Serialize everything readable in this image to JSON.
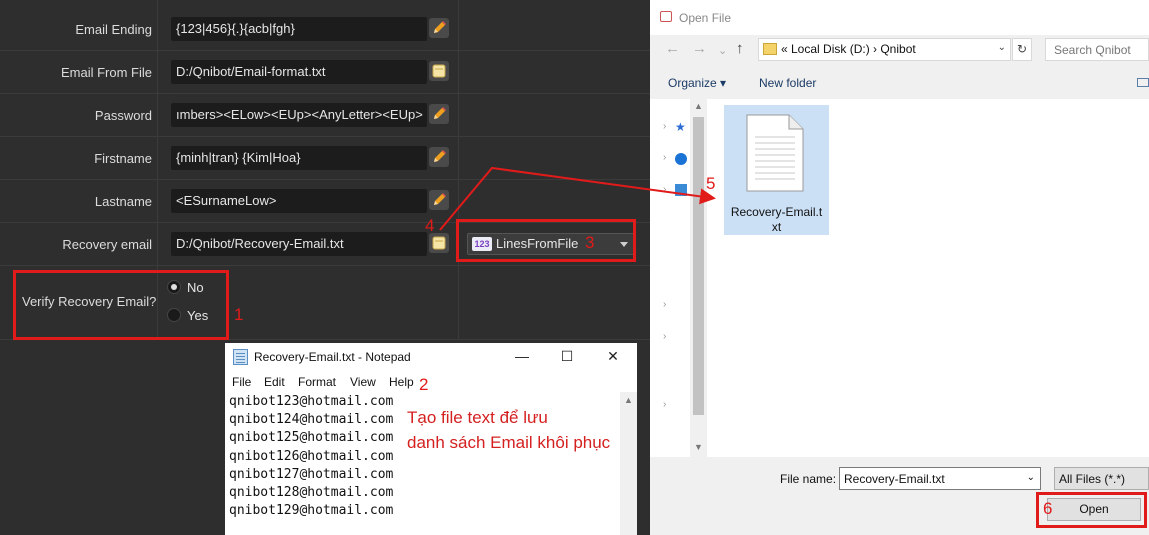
{
  "form": {
    "rows": [
      {
        "label": "Email Ending",
        "value": "{123|456}{.}{acb|fgh}",
        "button": "edit"
      },
      {
        "label": "Email From File",
        "value": "D:/Qnibot/Email-format.txt",
        "button": "file"
      },
      {
        "label": "Password",
        "value": "ımbers><ELow><EUp><AnyLetter><EUp>",
        "button": "edit"
      },
      {
        "label": "Firstname",
        "value": "{minh|tran} {Kim|Hoa}",
        "button": "edit"
      },
      {
        "label": "Lastname",
        "value": "<ESurnameLow>",
        "button": "edit"
      },
      {
        "label": "Recovery email",
        "value": "D:/Qnibot/Recovery-Email.txt",
        "button": "file"
      }
    ],
    "dropdown": {
      "badge": "123",
      "value": "LinesFromFile"
    },
    "verify_label": "Verify Recovery Email?",
    "radio_no": "No",
    "radio_yes": "Yes",
    "radio_selected": "No"
  },
  "annotations": {
    "n1": "1",
    "n2": "2",
    "n3": "3",
    "n4": "4",
    "n5": "5",
    "n6": "6",
    "note_line1": "Tạo file text để lưu",
    "note_line2": "danh sách Email khôi phục",
    "color": "#e11a1a"
  },
  "notepad": {
    "title": "Recovery-Email.txt - Notepad",
    "menu": [
      "File",
      "Edit",
      "Format",
      "View",
      "Help"
    ],
    "lines": [
      "qnibot123@hotmail.com",
      "qnibot124@hotmail.com",
      "qnibot125@hotmail.com",
      "qnibot126@hotmail.com",
      "qnibot127@hotmail.com",
      "qnibot128@hotmail.com",
      "qnibot129@hotmail.com"
    ]
  },
  "dialog": {
    "title": "Open File",
    "address": "«  Local Disk (D:)  ›  Qnibot",
    "search_placeholder": "Search Qnibot",
    "organize": "Organize ▾",
    "new_folder": "New folder",
    "file_name_1": "Recovery-Email.t",
    "file_name_2": "xt",
    "file_name_label": "File name:",
    "file_name_value": "Recovery-Email.txt",
    "file_type": "All Files (*.*)",
    "open_label": "Open"
  }
}
